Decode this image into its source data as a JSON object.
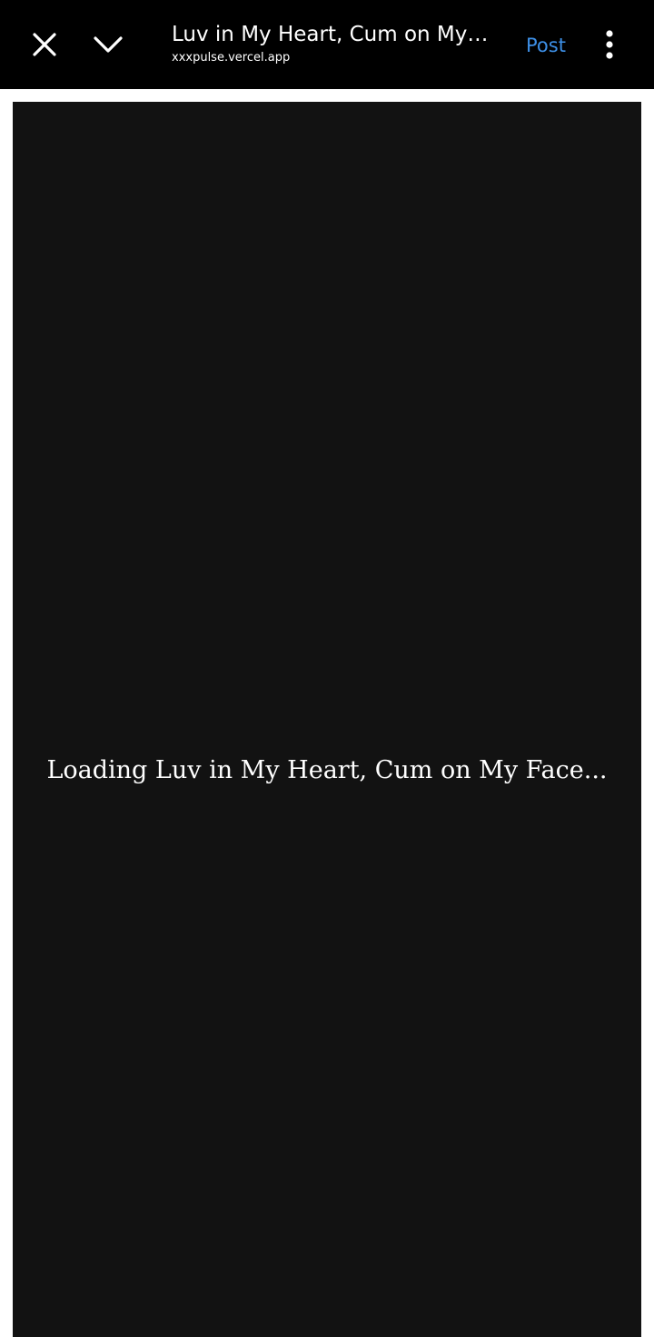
{
  "browser_bar": {
    "title": "Luv in My Heart, Cum on My Fa...",
    "url": "xxxpulse.vercel.app",
    "post_label": "Post",
    "close_icon": "close-icon",
    "collapse_icon": "chevron-down-icon",
    "menu_icon": "more-vert-icon",
    "accent_color": "#3d8fe6"
  },
  "content": {
    "loading_message": "Loading Luv in My Heart, Cum on My Face...",
    "background_color": "#121212"
  }
}
